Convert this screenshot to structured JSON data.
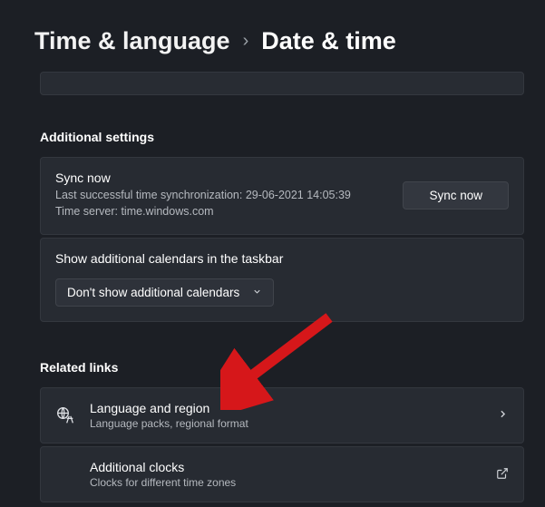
{
  "breadcrumb": {
    "parent": "Time & language",
    "current": "Date & time"
  },
  "sections": {
    "additional": "Additional settings",
    "related": "Related links"
  },
  "sync": {
    "title": "Sync now",
    "last_sync_line": "Last successful time synchronization: 29-06-2021 14:05:39",
    "server_line": "Time server: time.windows.com",
    "button": "Sync now"
  },
  "calendars": {
    "label": "Show additional calendars in the taskbar",
    "selected": "Don't show additional calendars"
  },
  "links": {
    "lang": {
      "title": "Language and region",
      "sub": "Language packs, regional format"
    },
    "clocks": {
      "title": "Additional clocks",
      "sub": "Clocks for different time zones"
    }
  }
}
